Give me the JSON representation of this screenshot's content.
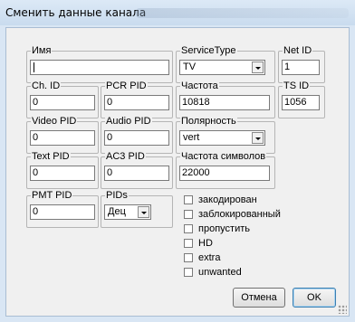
{
  "window": {
    "title": "Сменить данные канала"
  },
  "fields": {
    "name": {
      "label": "Имя",
      "value": ""
    },
    "servicetype": {
      "label": "ServiceType",
      "value": "TV"
    },
    "netid": {
      "label": "Net ID",
      "value": "1"
    },
    "chid": {
      "label": "Ch. ID",
      "value": "0"
    },
    "pcrpid": {
      "label": "PCR PID",
      "value": "0"
    },
    "freq": {
      "label": "Частота",
      "value": "10818"
    },
    "tsid": {
      "label": "TS ID",
      "value": "1056"
    },
    "videopid": {
      "label": "Video PID",
      "value": "0"
    },
    "audiopid": {
      "label": "Audio PID",
      "value": "0"
    },
    "polarity": {
      "label": "Полярность",
      "value": "vert"
    },
    "textpid": {
      "label": "Text PID",
      "value": "0"
    },
    "ac3pid": {
      "label": "AC3 PID",
      "value": "0"
    },
    "symrate": {
      "label": "Частота символов",
      "value": "22000"
    },
    "pmtpid": {
      "label": "PMT PID",
      "value": "0"
    },
    "pids": {
      "label": "PIDs",
      "value": "Дец"
    }
  },
  "checkboxes": [
    {
      "label": "закодирован",
      "checked": false
    },
    {
      "label": "заблокированный",
      "checked": false
    },
    {
      "label": "пропустить",
      "checked": false
    },
    {
      "label": "HD",
      "checked": false
    },
    {
      "label": "extra",
      "checked": false
    },
    {
      "label": "unwanted",
      "checked": false
    }
  ],
  "buttons": {
    "cancel": "Отмена",
    "ok": "OK"
  }
}
